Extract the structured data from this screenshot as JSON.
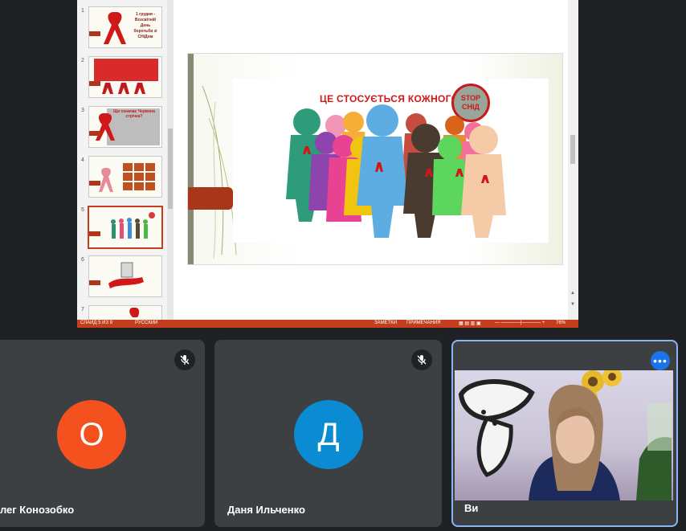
{
  "presentation": {
    "thumbnails": [
      {
        "num": "1",
        "text": "1 грудня - Всесвітній День боротьби зі СНІДом"
      },
      {
        "num": "2",
        "text": ""
      },
      {
        "num": "3",
        "text": "Що означає Червона стрічка?"
      },
      {
        "num": "4",
        "text": ""
      },
      {
        "num": "5",
        "text": ""
      },
      {
        "num": "6",
        "text": ""
      },
      {
        "num": "7",
        "text": ""
      }
    ],
    "slide": {
      "heading": "ЦЕ СТОСУЄТЬСЯ КОЖНОГО!",
      "stamp_line1": "STOP",
      "stamp_line2": "СНІД"
    },
    "status": {
      "slide_counter": "СЛАЙД 5 ИЗ 9",
      "language": "РУССКИЙ",
      "notes": "ЗАМЕТКИ",
      "comments": "ПРИМЕЧАНИЯ",
      "zoom": "76%"
    }
  },
  "participants": [
    {
      "initial": "О",
      "name": "Олег Конозобко",
      "color": "#f4511e"
    },
    {
      "initial": "Д",
      "name": "Даня Ильченко",
      "color": "#0b8bd2"
    },
    {
      "name": "Ви"
    }
  ],
  "more_glyph": "•••"
}
